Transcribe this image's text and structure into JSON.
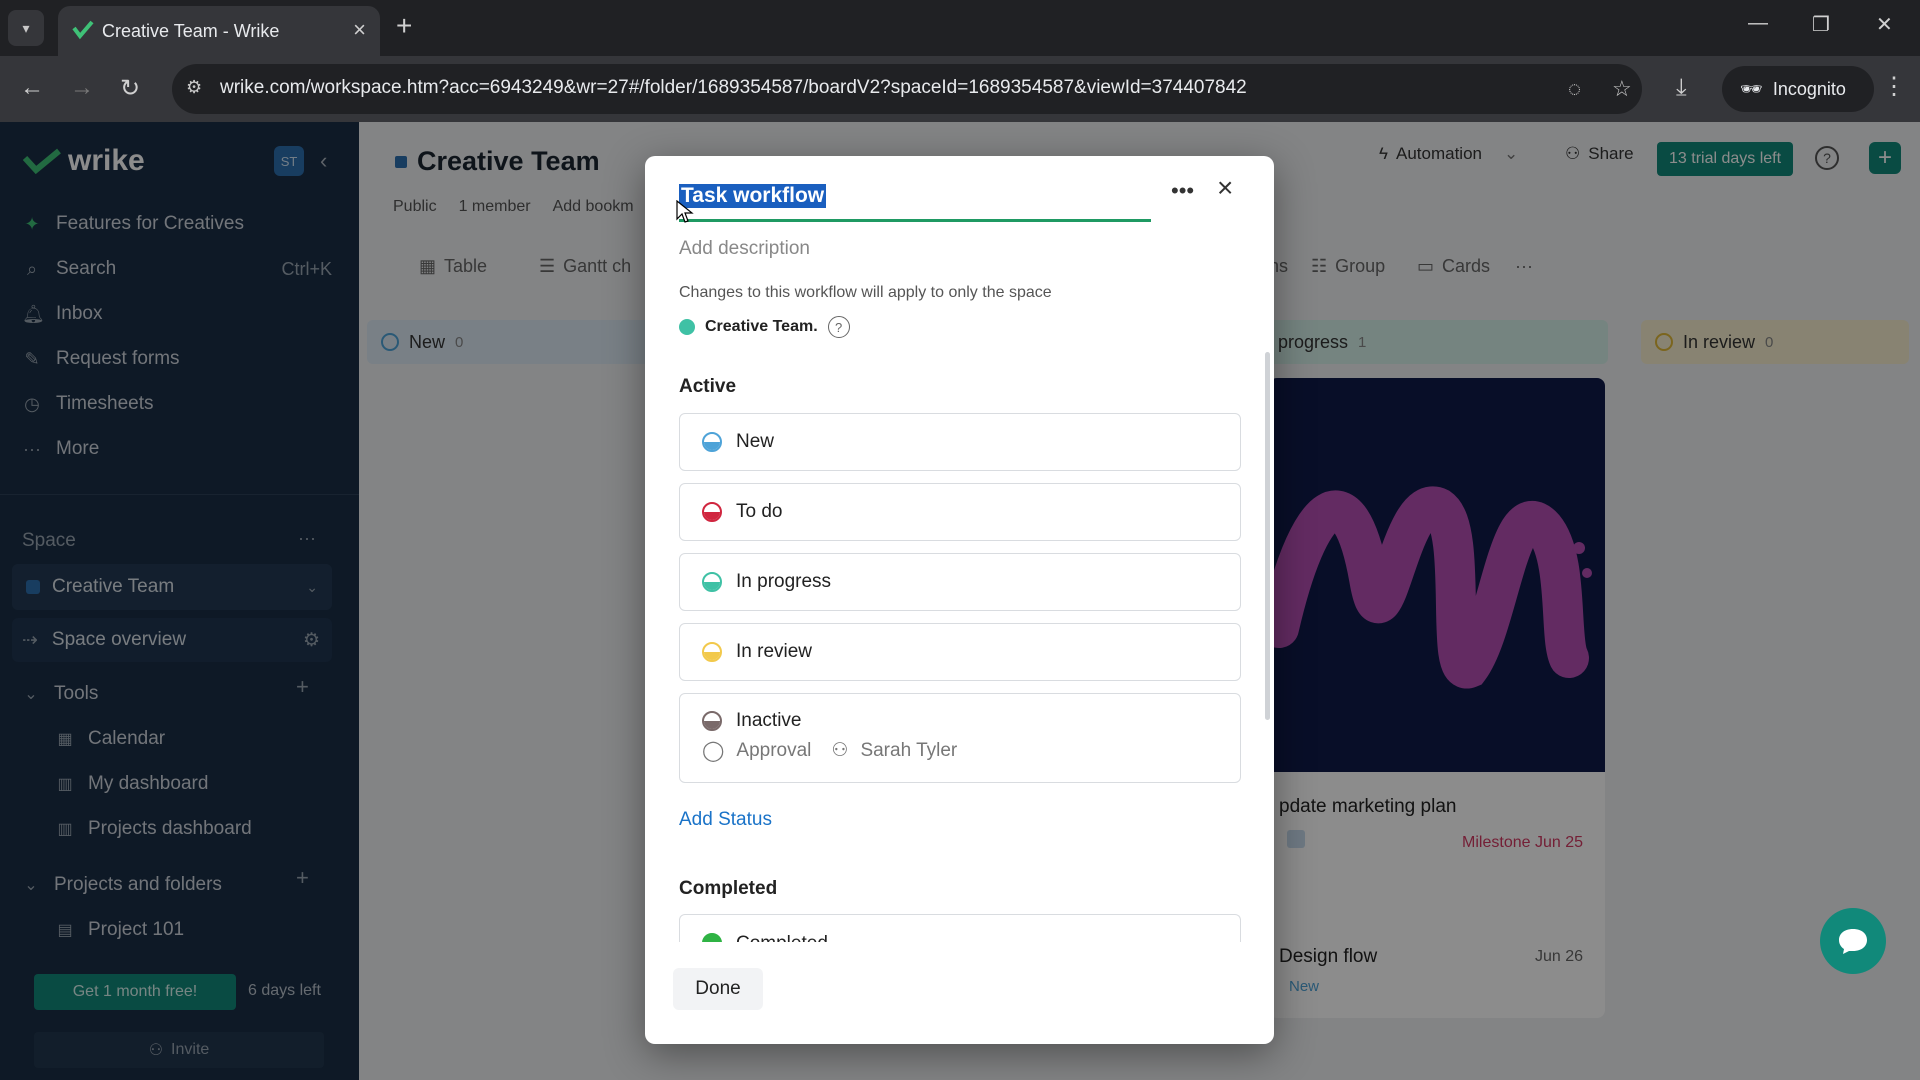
{
  "browser": {
    "tab_title": "Creative Team - Wrike",
    "url": "wrike.com/workspace.htm?acc=6943249&wr=27#/folder/1689354587/boardV2?spaceId=1689354587&viewId=374407842",
    "incognito_label": "Incognito"
  },
  "sidebar": {
    "logo": "wrike",
    "badge": "ST",
    "items": [
      {
        "label": "Features for Creatives",
        "icon": "sparkle-icon"
      },
      {
        "label": "Search",
        "icon": "search-icon",
        "shortcut": "Ctrl+K"
      },
      {
        "label": "Inbox",
        "icon": "bell-icon"
      },
      {
        "label": "Request forms",
        "icon": "form-icon"
      },
      {
        "label": "Timesheets",
        "icon": "clock-icon"
      },
      {
        "label": "More",
        "icon": "ellipsis-icon"
      }
    ],
    "space_label": "Space",
    "space_selected": "Creative Team",
    "space_overview": "Space overview",
    "tools_label": "Tools",
    "tools": [
      "Calendar",
      "My dashboard",
      "Projects dashboard"
    ],
    "projects_label": "Projects and folders",
    "projects": [
      "Project 101"
    ],
    "trial_button": "Get 1 month free!",
    "trial_days": "6 days left",
    "invite": "Invite"
  },
  "main": {
    "title": "Creative Team",
    "meta": [
      "Public",
      "1 member",
      "Add bookm"
    ],
    "automation": "Automation",
    "share": "Share",
    "trial_pill": "13 trial days left",
    "views": [
      "Table",
      "Gantt ch"
    ],
    "toolbar": [
      "ns",
      "Group",
      "Cards"
    ],
    "columns": [
      {
        "name": "New",
        "count": "0",
        "color": "#4ea3d8"
      },
      {
        "name": "progress",
        "count": "1",
        "color": "#3fc1a5"
      },
      {
        "name": "In review",
        "count": "0",
        "color": "#f2c94c"
      }
    ],
    "card": {
      "title": "pdate marketing plan",
      "milestone": "Milestone Jun 25",
      "title2": "Design flow",
      "date2": "Jun 26",
      "status2": "New"
    }
  },
  "modal": {
    "title": "Task workflow",
    "add_description": "Add description",
    "changes_note": "Changes to this workflow will apply to only the space",
    "space_name": "Creative Team.",
    "active_label": "Active",
    "statuses": [
      {
        "name": "New",
        "color": "#4ea3d8"
      },
      {
        "name": "To do",
        "color": "#d0263f"
      },
      {
        "name": "In progress",
        "color": "#3fc1a5"
      },
      {
        "name": "In review",
        "color": "#f2c94c"
      }
    ],
    "inactive": {
      "name": "Inactive",
      "color": "#7a6a6a",
      "approval": "Approval",
      "assignee": "Sarah Tyler"
    },
    "add_status": "Add Status",
    "completed_label": "Completed",
    "completed_first": "Completed",
    "completed_color": "#2fb344",
    "done": "Done"
  }
}
